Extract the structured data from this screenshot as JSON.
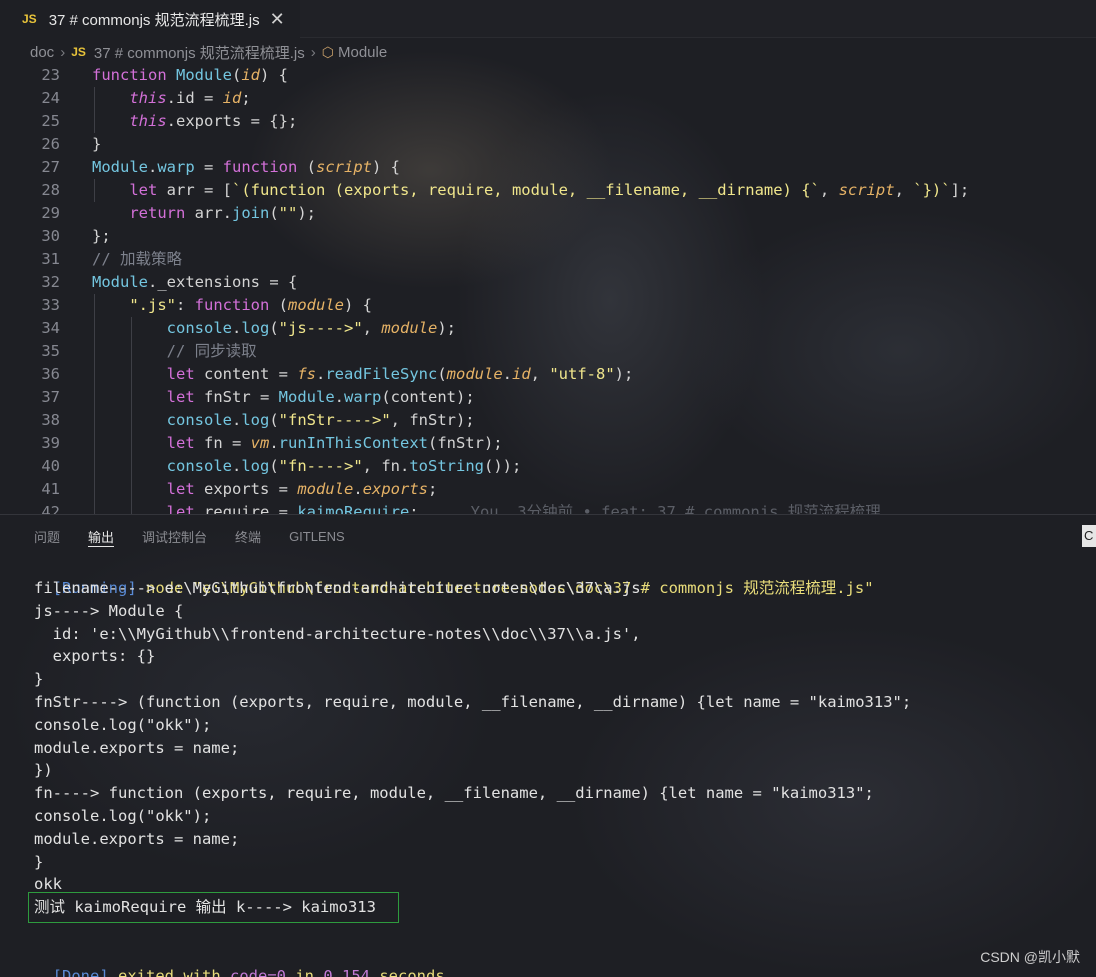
{
  "tab": {
    "badge": "JS",
    "title": "37 # commonjs 规范流程梳理.js",
    "close": "✕"
  },
  "breadcrumb": {
    "root": "doc",
    "badge": "JS",
    "file": "37 # commonjs 规范流程梳理.js",
    "symbol": "Module"
  },
  "editor": {
    "lines": [
      {
        "n": "23",
        "html": "<span class=\"kw\">function</span> <span class=\"fn\">Module</span>(<span class=\"it\">id</span>) {"
      },
      {
        "n": "24",
        "html": "    <span class=\"this\">this</span>.id = <span class=\"it\">id</span>;"
      },
      {
        "n": "25",
        "html": "    <span class=\"this\">this</span>.exports = {};"
      },
      {
        "n": "26",
        "html": "}"
      },
      {
        "n": "27",
        "html": "<span class=\"fn\">Module</span>.<span class=\"fn\">warp</span> = <span class=\"kw\">function</span> (<span class=\"it\">script</span>) {"
      },
      {
        "n": "28",
        "html": "    <span class=\"kw\">let</span> arr = [<span class=\"str\">`(function (exports, require, module, __filename, __dirname) {`</span>, <span class=\"it\">script</span>, <span class=\"str\">`})`</span>];"
      },
      {
        "n": "29",
        "html": "    <span class=\"kw\">return</span> arr.<span class=\"fn\">join</span>(<span class=\"str\">\"\"</span>);"
      },
      {
        "n": "30",
        "html": "};"
      },
      {
        "n": "31",
        "html": "<span class=\"cm\">// 加载策略</span>"
      },
      {
        "n": "32",
        "html": "<span class=\"fn\">Module</span>._extensions = {"
      },
      {
        "n": "33",
        "html": "    <span class=\"str\">\".js\"</span>: <span class=\"kw\">function</span> (<span class=\"it\">module</span>) {"
      },
      {
        "n": "34",
        "html": "        <span class=\"fn\">console</span>.<span class=\"fn\">log</span>(<span class=\"str\">\"js---->\"</span>, <span class=\"it\">module</span>);"
      },
      {
        "n": "35",
        "html": "        <span class=\"cm\">// 同步读取</span>"
      },
      {
        "n": "36",
        "html": "        <span class=\"kw\">let</span> content = <span class=\"it\">fs</span>.<span class=\"fn\">readFileSync</span>(<span class=\"it\">module</span>.<span class=\"it\">id</span>, <span class=\"str\">\"utf-8\"</span>);"
      },
      {
        "n": "37",
        "html": "        <span class=\"kw\">let</span> fnStr = <span class=\"fn\">Module</span>.<span class=\"fn\">warp</span>(content);"
      },
      {
        "n": "38",
        "html": "        <span class=\"fn\">console</span>.<span class=\"fn\">log</span>(<span class=\"str\">\"fnStr---->\"</span>, fnStr);"
      },
      {
        "n": "39",
        "html": "        <span class=\"kw\">let</span> fn = <span class=\"it\">vm</span>.<span class=\"fn\">runInThisContext</span>(fnStr);"
      },
      {
        "n": "40",
        "html": "        <span class=\"fn\">console</span>.<span class=\"fn\">log</span>(<span class=\"str\">\"fn---->\"</span>, fn.<span class=\"fn\">toString</span>());"
      },
      {
        "n": "41",
        "html": "        <span class=\"kw\">let</span> exports = <span class=\"it\">module</span>.<span class=\"it\">exports</span>;"
      },
      {
        "n": "42",
        "html": "        <span class=\"kw\">let</span> require = <span class=\"fn\">kaimoRequire</span>;<span class=\"blame\">You, 3分钟前 • feat: 37 # commonjs 规范流程梳理</span>"
      }
    ]
  },
  "panel": {
    "tabs": [
      "问题",
      "输出",
      "调试控制台",
      "终端",
      "GITLENS"
    ],
    "active_tab": "输出",
    "right_button": "C"
  },
  "output": {
    "running_tag": "[Running]",
    "running_cmd": " node \"e:\\MyGithub\\frontend-architecture-notes\\doc\\37 # commonjs 规范流程梳理.js\"",
    "lines": [
      "filename----> e:\\MyGithub\\frontend-architecture-notes\\doc\\37\\a.js",
      "js----> Module {",
      "  id: 'e:\\\\MyGithub\\\\frontend-architecture-notes\\\\doc\\\\37\\\\a.js',",
      "  exports: {}",
      "}",
      "fnStr----> (function (exports, require, module, __filename, __dirname) {let name = \"kaimo313\";",
      "console.log(\"okk\");",
      "module.exports = name;",
      "})",
      "fn----> function (exports, require, module, __filename, __dirname) {let name = \"kaimo313\";",
      "console.log(\"okk\");",
      "module.exports = name;",
      "}",
      "okk",
      "测试 kaimoRequire 输出 k----> kaimo313"
    ],
    "done_tag": "[Done]",
    "done_text1": " exited with ",
    "done_code": "code=0",
    "done_text2": " in ",
    "done_time": "0.154",
    "done_text3": " seconds"
  },
  "watermark": "CSDN @凯小默"
}
